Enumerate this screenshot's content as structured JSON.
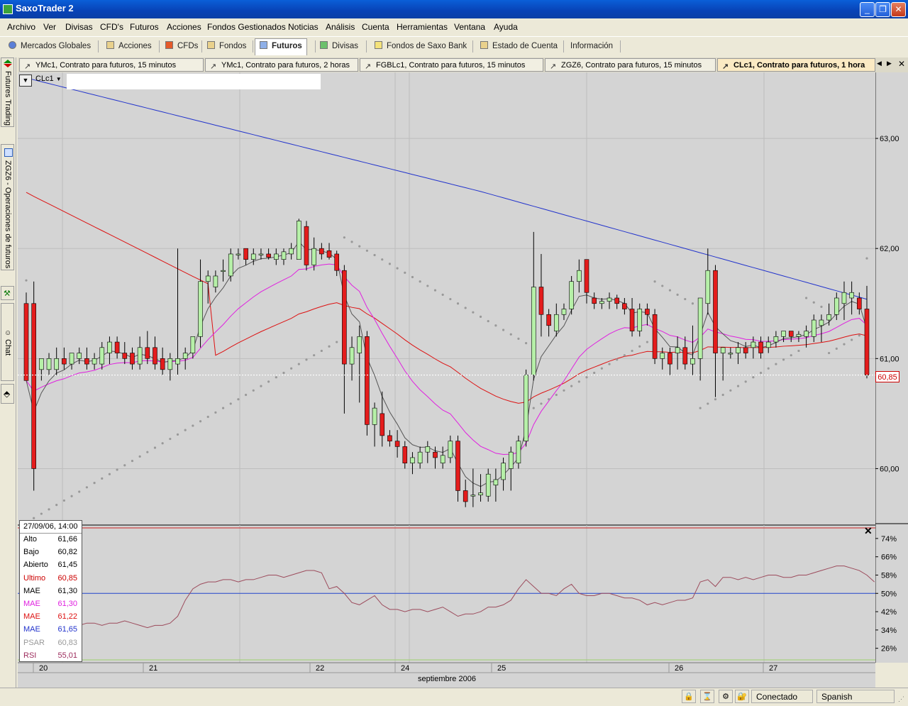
{
  "app": {
    "title": "SaxoTrader 2"
  },
  "menu": [
    "Archivo",
    "Ver",
    "Divisas",
    "CFD's",
    "Futuros",
    "Acciones",
    "Fondos Gestionados",
    "Noticias",
    "Análisis",
    "Cuenta",
    "Herramientas",
    "Ventana",
    "Ayuda"
  ],
  "main_tabs": [
    {
      "label": "Mercados Globales",
      "icon": "globe-icon"
    },
    {
      "label": "Acciones",
      "icon": "stock-icon"
    },
    {
      "label": "CFDs",
      "icon": "cfd-icon"
    },
    {
      "label": "Fondos",
      "icon": "fund-icon"
    },
    {
      "label": "Futuros",
      "icon": "futures-icon",
      "active": true
    },
    {
      "label": "Divisas",
      "icon": "fx-icon"
    },
    {
      "label": "Fondos de Saxo Bank",
      "icon": "saxo-fund-icon"
    },
    {
      "label": "Estado de Cuenta",
      "icon": "account-icon"
    },
    {
      "label": "Información",
      "icon": ""
    }
  ],
  "chart_tabs": [
    {
      "label": "YMc1, Contrato para futuros, 15 minutos"
    },
    {
      "label": "YMc1, Contrato para futuros, 2 horas"
    },
    {
      "label": "FGBLc1, Contrato para futuros, 15 minutos"
    },
    {
      "label": "ZGZ6, Contrato para futuros, 15 minutos"
    },
    {
      "label": "CLc1, Contrato para futuros, 1 hora",
      "active": true
    }
  ],
  "side_tabs": [
    "Futures Trading",
    "ZGZ6 - Operaciones de futuros",
    "Chat"
  ],
  "symbol": "CLc1",
  "price_axis": [
    "63,00",
    "62,00",
    "61,00",
    "60,00"
  ],
  "rsi_axis": [
    "74%",
    "66%",
    "58%",
    "50%",
    "42%",
    "34%",
    "26%"
  ],
  "last_price_tag": "60,85",
  "date_axis": [
    "20",
    "21",
    "22",
    "24",
    "25",
    "26",
    "27"
  ],
  "month_label": "septiembre 2006",
  "info": {
    "datetime": "27/09/06, 14:00",
    "rows": [
      {
        "label": "Alto",
        "value": "61,66",
        "color": "#000000"
      },
      {
        "label": "Bajo",
        "value": "60,82",
        "color": "#000000"
      },
      {
        "label": "Abierto",
        "value": "61,45",
        "color": "#000000"
      },
      {
        "label": "Ultimo",
        "value": "60,85",
        "color": "#cc0000"
      },
      {
        "label": "MAE",
        "value": "61,30",
        "color": "#000000"
      },
      {
        "label": "MAE",
        "value": "61,30",
        "color": "#e020e0"
      },
      {
        "label": "MAE",
        "value": "61,22",
        "color": "#dd1111"
      },
      {
        "label": "MAE",
        "value": "61,65",
        "color": "#2233cc"
      },
      {
        "label": "PSAR",
        "value": "60,83",
        "color": "#999999"
      },
      {
        "label": "RSI",
        "value": "55,01",
        "color": "#9c2b5c"
      }
    ]
  },
  "status": {
    "connection": "Conectado",
    "language": "Spanish"
  },
  "chart_data": {
    "type": "line",
    "price_ylim": [
      59.5,
      63.6
    ],
    "ohlc": [
      {
        "o": 61.5,
        "h": 61.6,
        "l": 60.8,
        "c": 60.8
      },
      {
        "o": 61.5,
        "h": 61.7,
        "l": 59.8,
        "c": 60.0
      },
      {
        "o": 60.9,
        "h": 61.0,
        "l": 60.8,
        "c": 61.0
      },
      {
        "o": 60.9,
        "h": 61.05,
        "l": 60.85,
        "c": 61.0
      },
      {
        "o": 60.9,
        "h": 61.1,
        "l": 60.85,
        "c": 61.0
      },
      {
        "o": 61.0,
        "h": 61.1,
        "l": 60.9,
        "c": 60.95
      },
      {
        "o": 60.95,
        "h": 61.05,
        "l": 60.9,
        "c": 61.05
      },
      {
        "o": 61.0,
        "h": 61.1,
        "l": 60.95,
        "c": 61.05
      },
      {
        "o": 61.0,
        "h": 61.1,
        "l": 60.9,
        "c": 60.95
      },
      {
        "o": 60.95,
        "h": 61.05,
        "l": 60.9,
        "c": 61.0
      },
      {
        "o": 60.95,
        "h": 61.15,
        "l": 60.9,
        "c": 61.1
      },
      {
        "o": 61.05,
        "h": 61.2,
        "l": 60.95,
        "c": 61.15
      },
      {
        "o": 61.15,
        "h": 61.2,
        "l": 61.0,
        "c": 61.05
      },
      {
        "o": 61.05,
        "h": 61.15,
        "l": 60.95,
        "c": 61.0
      },
      {
        "o": 61.05,
        "h": 61.1,
        "l": 60.9,
        "c": 60.95
      },
      {
        "o": 60.95,
        "h": 61.2,
        "l": 60.9,
        "c": 61.1
      },
      {
        "o": 61.1,
        "h": 61.25,
        "l": 60.95,
        "c": 61.0
      },
      {
        "o": 61.1,
        "h": 61.2,
        "l": 60.9,
        "c": 60.95
      },
      {
        "o": 61.0,
        "h": 61.1,
        "l": 60.85,
        "c": 60.9
      },
      {
        "o": 60.9,
        "h": 61.05,
        "l": 60.8,
        "c": 61.0
      },
      {
        "o": 60.95,
        "h": 62.0,
        "l": 60.85,
        "c": 61.0
      },
      {
        "o": 61.0,
        "h": 61.1,
        "l": 60.9,
        "c": 61.05
      },
      {
        "o": 61.05,
        "h": 61.2,
        "l": 61.0,
        "c": 61.2
      },
      {
        "o": 61.2,
        "h": 61.9,
        "l": 61.1,
        "c": 61.7
      },
      {
        "o": 61.7,
        "h": 61.8,
        "l": 61.5,
        "c": 61.75
      },
      {
        "o": 61.65,
        "h": 61.8,
        "l": 61.6,
        "c": 61.75
      },
      {
        "o": 61.8,
        "h": 61.9,
        "l": 61.7,
        "c": 61.8
      },
      {
        "o": 61.75,
        "h": 62.0,
        "l": 61.7,
        "c": 61.95
      },
      {
        "o": 61.95,
        "h": 62.0,
        "l": 61.9,
        "c": 61.95
      },
      {
        "o": 62.0,
        "h": 62.0,
        "l": 61.85,
        "c": 61.9
      },
      {
        "o": 61.9,
        "h": 62.0,
        "l": 61.85,
        "c": 61.95
      },
      {
        "o": 61.95,
        "h": 62.0,
        "l": 61.9,
        "c": 61.95
      },
      {
        "o": 61.95,
        "h": 62.0,
        "l": 61.9,
        "c": 61.92
      },
      {
        "o": 61.9,
        "h": 62.0,
        "l": 61.85,
        "c": 61.95
      },
      {
        "o": 61.9,
        "h": 62.0,
        "l": 61.85,
        "c": 61.97
      },
      {
        "o": 61.95,
        "h": 62.05,
        "l": 61.9,
        "c": 62.0
      },
      {
        "o": 61.9,
        "h": 62.27,
        "l": 61.9,
        "c": 62.25
      },
      {
        "o": 62.2,
        "h": 62.25,
        "l": 61.8,
        "c": 61.85
      },
      {
        "o": 61.85,
        "h": 62.1,
        "l": 61.8,
        "c": 62.0
      },
      {
        "o": 62.0,
        "h": 62.05,
        "l": 61.9,
        "c": 61.95
      },
      {
        "o": 61.98,
        "h": 62.05,
        "l": 61.9,
        "c": 61.92
      },
      {
        "o": 61.95,
        "h": 61.98,
        "l": 61.75,
        "c": 61.8
      },
      {
        "o": 61.8,
        "h": 61.85,
        "l": 60.5,
        "c": 60.95
      },
      {
        "o": 60.95,
        "h": 61.2,
        "l": 60.8,
        "c": 61.1
      },
      {
        "o": 61.05,
        "h": 61.3,
        "l": 60.6,
        "c": 61.2
      },
      {
        "o": 61.2,
        "h": 61.25,
        "l": 60.3,
        "c": 60.4
      },
      {
        "o": 60.4,
        "h": 60.6,
        "l": 60.2,
        "c": 60.55
      },
      {
        "o": 60.5,
        "h": 60.7,
        "l": 60.2,
        "c": 60.3
      },
      {
        "o": 60.3,
        "h": 60.35,
        "l": 60.2,
        "c": 60.25
      },
      {
        "o": 60.25,
        "h": 60.35,
        "l": 60.1,
        "c": 60.2
      },
      {
        "o": 60.2,
        "h": 60.25,
        "l": 60.0,
        "c": 60.05
      },
      {
        "o": 60.05,
        "h": 60.15,
        "l": 59.95,
        "c": 60.1
      },
      {
        "o": 60.05,
        "h": 60.2,
        "l": 60.0,
        "c": 60.15
      },
      {
        "o": 60.15,
        "h": 60.25,
        "l": 60.05,
        "c": 60.2
      },
      {
        "o": 60.15,
        "h": 60.2,
        "l": 60.0,
        "c": 60.1
      },
      {
        "o": 60.05,
        "h": 60.2,
        "l": 60.0,
        "c": 60.12
      },
      {
        "o": 60.1,
        "h": 60.3,
        "l": 60.05,
        "c": 60.25
      },
      {
        "o": 60.25,
        "h": 60.3,
        "l": 59.7,
        "c": 59.8
      },
      {
        "o": 59.8,
        "h": 59.9,
        "l": 59.65,
        "c": 59.7
      },
      {
        "o": 59.75,
        "h": 60.0,
        "l": 59.65,
        "c": 59.76
      },
      {
        "o": 59.76,
        "h": 59.95,
        "l": 59.7,
        "c": 59.78
      },
      {
        "o": 59.75,
        "h": 60.0,
        "l": 59.7,
        "c": 59.95
      },
      {
        "o": 59.85,
        "h": 60.0,
        "l": 59.7,
        "c": 59.9
      },
      {
        "o": 59.9,
        "h": 60.1,
        "l": 59.8,
        "c": 60.05
      },
      {
        "o": 60.0,
        "h": 60.2,
        "l": 59.8,
        "c": 60.15
      },
      {
        "o": 60.05,
        "h": 60.3,
        "l": 60.0,
        "c": 60.25
      },
      {
        "o": 60.25,
        "h": 60.9,
        "l": 60.2,
        "c": 60.85
      },
      {
        "o": 60.85,
        "h": 62.15,
        "l": 60.8,
        "c": 61.65
      },
      {
        "o": 61.65,
        "h": 61.95,
        "l": 61.2,
        "c": 61.4
      },
      {
        "o": 61.4,
        "h": 61.45,
        "l": 61.2,
        "c": 61.3
      },
      {
        "o": 61.25,
        "h": 61.5,
        "l": 61.2,
        "c": 61.4
      },
      {
        "o": 61.4,
        "h": 61.5,
        "l": 61.35,
        "c": 61.45
      },
      {
        "o": 61.45,
        "h": 61.75,
        "l": 61.4,
        "c": 61.7
      },
      {
        "o": 61.7,
        "h": 61.9,
        "l": 61.6,
        "c": 61.8
      },
      {
        "o": 61.9,
        "h": 61.9,
        "l": 61.5,
        "c": 61.6
      },
      {
        "o": 61.55,
        "h": 61.6,
        "l": 61.45,
        "c": 61.5
      },
      {
        "o": 61.5,
        "h": 61.55,
        "l": 61.45,
        "c": 61.52
      },
      {
        "o": 61.52,
        "h": 61.6,
        "l": 61.45,
        "c": 61.55
      },
      {
        "o": 61.55,
        "h": 61.58,
        "l": 61.45,
        "c": 61.5
      },
      {
        "o": 61.5,
        "h": 61.55,
        "l": 61.4,
        "c": 61.45
      },
      {
        "o": 61.45,
        "h": 61.55,
        "l": 61.2,
        "c": 61.25
      },
      {
        "o": 61.25,
        "h": 61.5,
        "l": 61.2,
        "c": 61.45
      },
      {
        "o": 61.45,
        "h": 61.5,
        "l": 61.3,
        "c": 61.4
      },
      {
        "o": 61.4,
        "h": 61.45,
        "l": 60.95,
        "c": 61.0
      },
      {
        "o": 61.0,
        "h": 61.1,
        "l": 60.9,
        "c": 61.05
      },
      {
        "o": 61.05,
        "h": 61.1,
        "l": 60.85,
        "c": 60.95
      },
      {
        "o": 61.05,
        "h": 61.2,
        "l": 60.9,
        "c": 61.1
      },
      {
        "o": 61.1,
        "h": 61.2,
        "l": 60.9,
        "c": 60.95
      },
      {
        "o": 60.95,
        "h": 61.3,
        "l": 60.85,
        "c": 61.0
      },
      {
        "o": 61.0,
        "h": 61.55,
        "l": 60.8,
        "c": 61.55
      },
      {
        "o": 61.5,
        "h": 62.0,
        "l": 61.4,
        "c": 61.8
      },
      {
        "o": 61.8,
        "h": 61.85,
        "l": 60.65,
        "c": 61.05
      },
      {
        "o": 61.05,
        "h": 61.1,
        "l": 60.8,
        "c": 61.1
      },
      {
        "o": 61.05,
        "h": 61.1,
        "l": 61.0,
        "c": 61.05
      },
      {
        "o": 61.05,
        "h": 61.15,
        "l": 60.95,
        "c": 61.1
      },
      {
        "o": 61.1,
        "h": 61.15,
        "l": 61.0,
        "c": 61.05
      },
      {
        "o": 61.1,
        "h": 61.2,
        "l": 61.0,
        "c": 61.15
      },
      {
        "o": 61.15,
        "h": 61.2,
        "l": 61.0,
        "c": 61.05
      },
      {
        "o": 61.1,
        "h": 61.2,
        "l": 61.05,
        "c": 61.15
      },
      {
        "o": 61.15,
        "h": 61.25,
        "l": 61.1,
        "c": 61.2
      },
      {
        "o": 61.2,
        "h": 61.25,
        "l": 61.15,
        "c": 61.25
      },
      {
        "o": 61.25,
        "h": 61.25,
        "l": 61.15,
        "c": 61.2
      },
      {
        "o": 61.2,
        "h": 61.25,
        "l": 61.15,
        "c": 61.22
      },
      {
        "o": 61.2,
        "h": 61.3,
        "l": 61.1,
        "c": 61.25
      },
      {
        "o": 61.2,
        "h": 61.4,
        "l": 61.15,
        "c": 61.35
      },
      {
        "o": 61.3,
        "h": 61.4,
        "l": 61.15,
        "c": 61.35
      },
      {
        "o": 61.35,
        "h": 61.5,
        "l": 61.3,
        "c": 61.4
      },
      {
        "o": 61.4,
        "h": 61.6,
        "l": 61.35,
        "c": 61.55
      },
      {
        "o": 61.5,
        "h": 61.7,
        "l": 61.35,
        "c": 61.6
      },
      {
        "o": 61.55,
        "h": 61.7,
        "l": 61.4,
        "c": 61.6
      },
      {
        "o": 61.55,
        "h": 61.6,
        "l": 61.4,
        "c": 61.45
      },
      {
        "o": 61.45,
        "h": 61.66,
        "l": 60.82,
        "c": 60.85
      }
    ],
    "rsi_ylim": [
      20,
      78
    ],
    "rsi": [
      36,
      35,
      35,
      35,
      36,
      36,
      35,
      36,
      37,
      37,
      36,
      37,
      37,
      38,
      37,
      36,
      35,
      36,
      36,
      37,
      40,
      47,
      52,
      54,
      55,
      55,
      56,
      56,
      55,
      56,
      56,
      57,
      58,
      58,
      57,
      58,
      59,
      60,
      60,
      59,
      52,
      53,
      50,
      46,
      45,
      47,
      49,
      45,
      43,
      43,
      42,
      43,
      43,
      42,
      43,
      44,
      42,
      40,
      41,
      41,
      42,
      44,
      44,
      45,
      47,
      52,
      56,
      53,
      50,
      50,
      49,
      52,
      54,
      50,
      49,
      49,
      50,
      50,
      49,
      48,
      48,
      47,
      45,
      46,
      45,
      46,
      47,
      47,
      48,
      55,
      56,
      53,
      57,
      57,
      56,
      57,
      56,
      57,
      58,
      58,
      57,
      57,
      58,
      58,
      59,
      60,
      61,
      62,
      62,
      61,
      60,
      58,
      55
    ],
    "rsi_levels": [
      74,
      50
    ],
    "series": [
      {
        "name": "MAE",
        "color": "#555555",
        "values": []
      },
      {
        "name": "MAE",
        "color": "#e020e0",
        "values": []
      },
      {
        "name": "MAE",
        "color": "#dd1111",
        "values": []
      },
      {
        "name": "MAE",
        "color": "#2233cc",
        "values": []
      },
      {
        "name": "PSAR",
        "color": "#999999",
        "values": []
      }
    ]
  }
}
